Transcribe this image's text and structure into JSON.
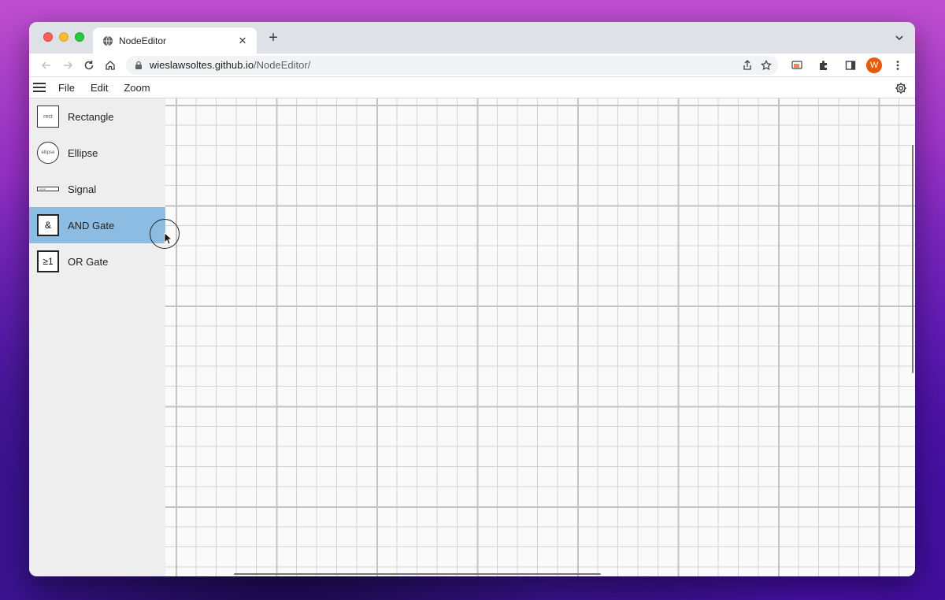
{
  "browser": {
    "tab_title": "NodeEditor",
    "close_glyph": "✕",
    "new_tab_glyph": "+",
    "url_host": "wieslawsoltes.github.io",
    "url_path": "/NodeEditor/",
    "profile_initial": "W"
  },
  "menubar": {
    "items": [
      "File",
      "Edit",
      "Zoom"
    ]
  },
  "sidebar": {
    "tools": [
      {
        "label": "Rectangle",
        "icon_text": "rect",
        "icon": "rectangle-icon"
      },
      {
        "label": "Ellipse",
        "icon_text": "ellipse",
        "icon": "ellipse-icon"
      },
      {
        "label": "Signal",
        "icon_text": "signal",
        "icon": "signal-icon"
      },
      {
        "label": "AND Gate",
        "icon_text": "&",
        "icon": "and-gate-icon",
        "selected": true
      },
      {
        "label": "OR Gate",
        "icon_text": "≥1",
        "icon": "or-gate-icon"
      }
    ]
  },
  "colors": {
    "selected_tool": "#8dbce3",
    "sidebar_bg": "#eeeeee",
    "avatar": "#e8590c"
  }
}
